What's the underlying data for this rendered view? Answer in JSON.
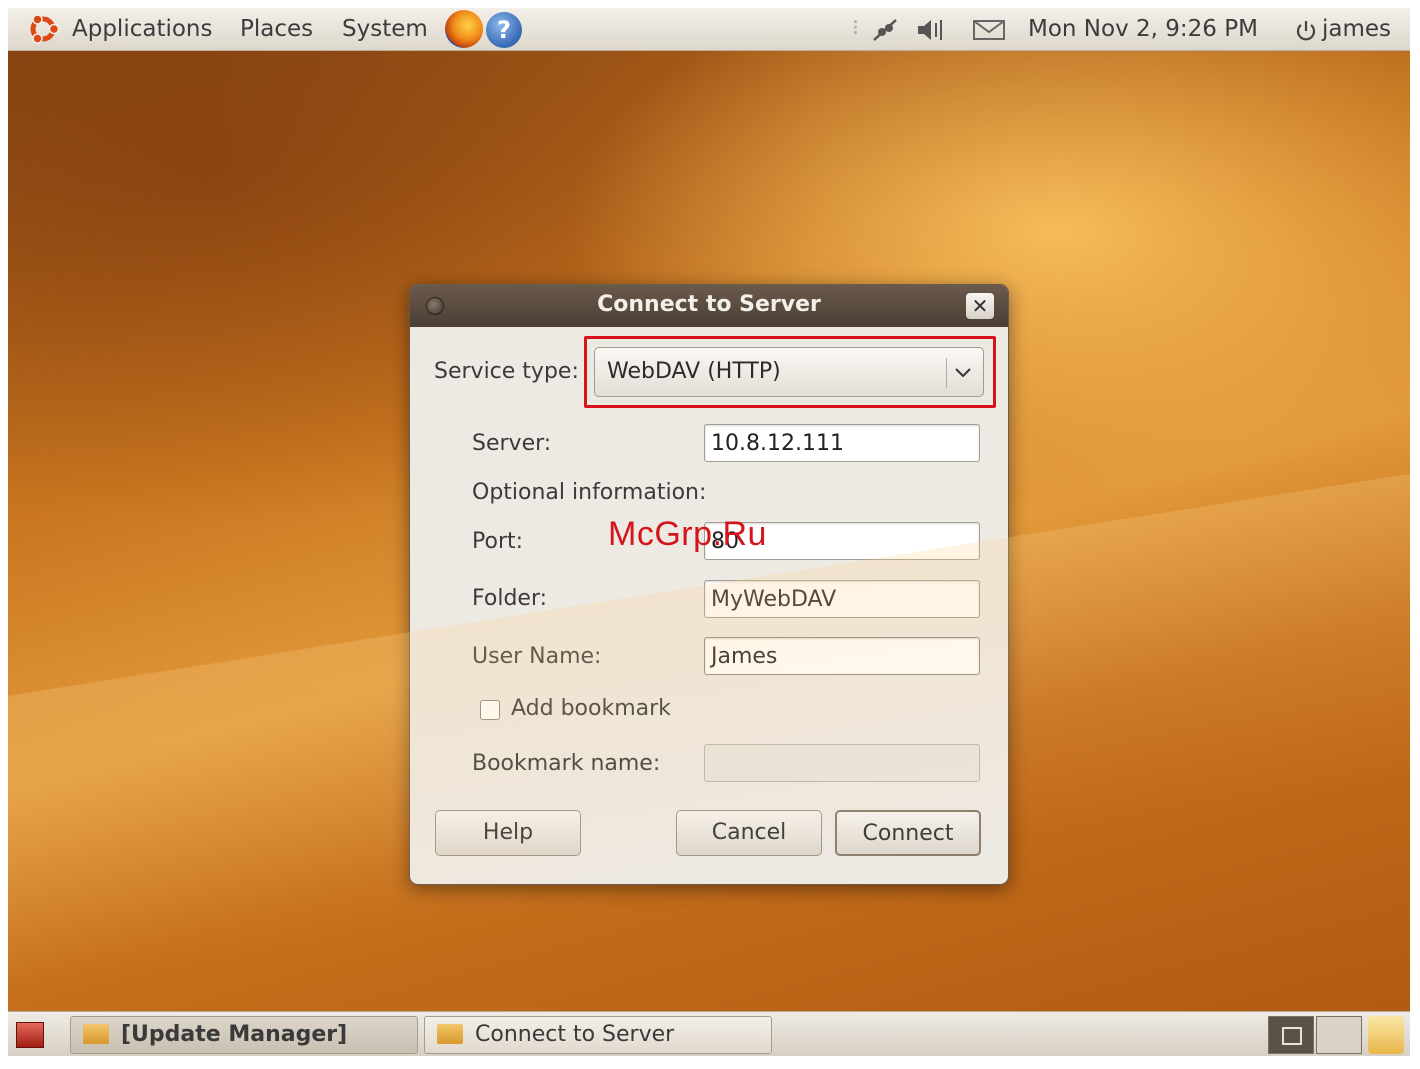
{
  "top_panel": {
    "menus": [
      "Applications",
      "Places",
      "System"
    ],
    "clock": "Mon Nov  2,  9:26 PM",
    "user": "james",
    "icons": [
      "ubuntu-logo-icon",
      "firefox-icon",
      "help-icon",
      "network-icon",
      "volume-icon",
      "mail-icon",
      "power-icon"
    ]
  },
  "dialog": {
    "title": "Connect to Server",
    "service_type_label": "Service type:",
    "service_type_value": "WebDAV (HTTP)",
    "server_label": "Server:",
    "server_value": "10.8.12.111",
    "optional_label": "Optional information:",
    "port_label": "Port:",
    "port_value": "80",
    "folder_label": "Folder:",
    "folder_value": "MyWebDAV",
    "username_label": "User Name:",
    "username_value": "James",
    "add_bookmark_label": "Add bookmark",
    "add_bookmark_checked": false,
    "bookmark_name_label": "Bookmark name:",
    "bookmark_name_value": "",
    "buttons": {
      "help": "Help",
      "cancel": "Cancel",
      "connect": "Connect"
    }
  },
  "watermark": "McGrp.Ru",
  "bottom_panel": {
    "tasks": [
      {
        "label": "[Update Manager]",
        "active": true
      },
      {
        "label": "Connect to Server",
        "active": false
      }
    ]
  },
  "colors": {
    "highlight": "#d8141a",
    "titlebar": "#4b3e33",
    "desktop": "#c9761f"
  }
}
